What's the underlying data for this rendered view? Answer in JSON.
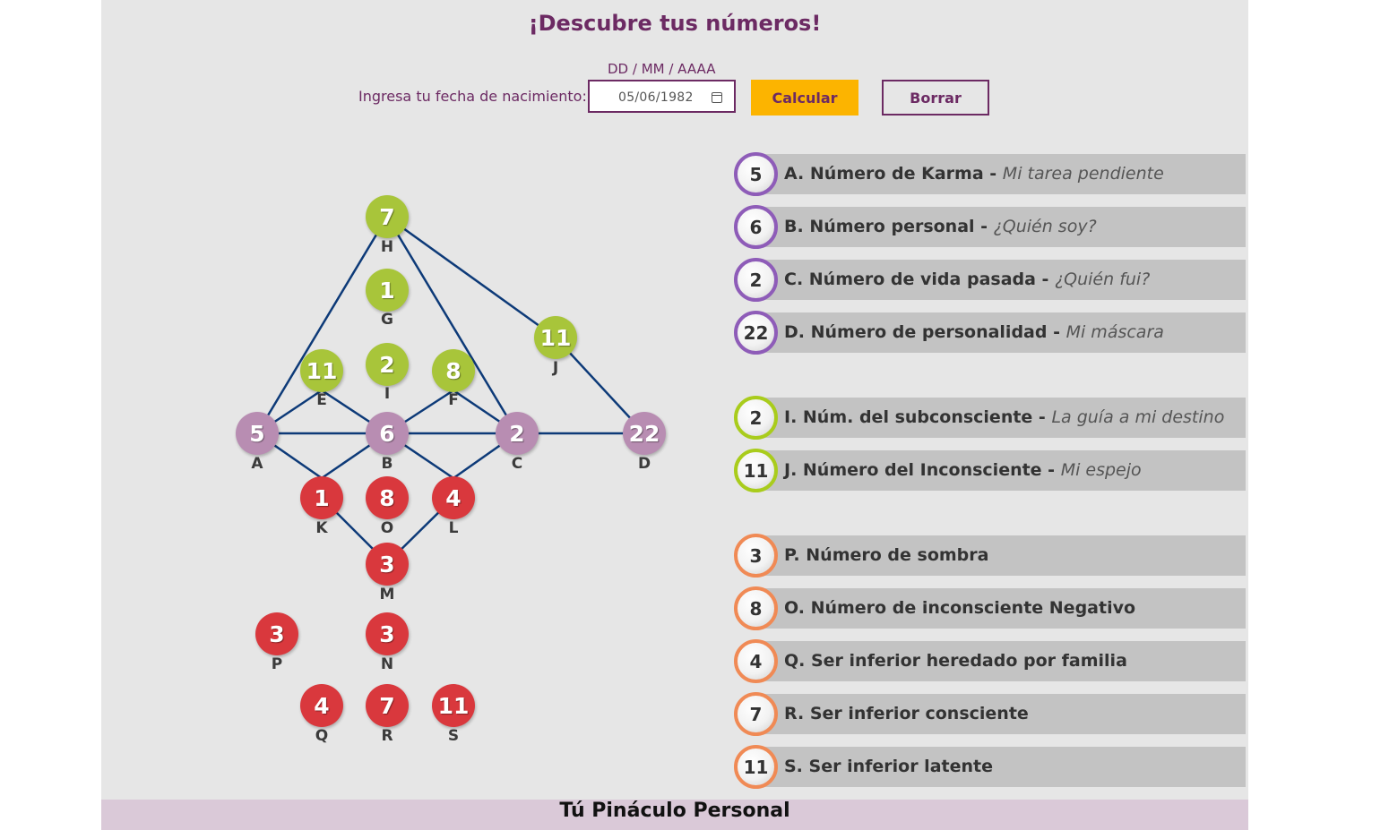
{
  "title": "¡Descubre tus números!",
  "form": {
    "format_hint": "DD / MM / AAAA",
    "label": "Ingresa tu fecha de nacimiento:",
    "date_value": "05/06/1982",
    "calc_button": "Calcular",
    "clear_button": "Borrar"
  },
  "diagram": {
    "nodes": {
      "H": {
        "value": "7",
        "label": "H"
      },
      "G": {
        "value": "1",
        "label": "G"
      },
      "I": {
        "value": "2",
        "label": "I"
      },
      "E": {
        "value": "11",
        "label": "E"
      },
      "F": {
        "value": "8",
        "label": "F"
      },
      "J": {
        "value": "11",
        "label": "J"
      },
      "A": {
        "value": "5",
        "label": "A"
      },
      "B": {
        "value": "6",
        "label": "B"
      },
      "C": {
        "value": "2",
        "label": "C"
      },
      "D": {
        "value": "22",
        "label": "D"
      },
      "K": {
        "value": "1",
        "label": "K"
      },
      "O": {
        "value": "8",
        "label": "O"
      },
      "L": {
        "value": "4",
        "label": "L"
      },
      "M": {
        "value": "3",
        "label": "M"
      },
      "P": {
        "value": "3",
        "label": "P"
      },
      "N": {
        "value": "3",
        "label": "N"
      },
      "Q": {
        "value": "4",
        "label": "Q"
      },
      "R": {
        "value": "7",
        "label": "R"
      },
      "S": {
        "value": "11",
        "label": "S"
      }
    }
  },
  "results": [
    {
      "value": "5",
      "title": "A. Número de Karma - ",
      "subtitle": "Mi tarea pendiente"
    },
    {
      "value": "6",
      "title": "B. Número personal - ",
      "subtitle": "¿Quién soy?"
    },
    {
      "value": "2",
      "title": "C. Número de vida pasada - ",
      "subtitle": "¿Quién fui?"
    },
    {
      "value": "22",
      "title": "D. Número de personalidad - ",
      "subtitle": "Mi máscara"
    },
    {
      "value": "2",
      "title": "I. Núm. del subconsciente - ",
      "subtitle": "La guía a mi destino"
    },
    {
      "value": "11",
      "title": "J. Número del Inconsciente - ",
      "subtitle": "Mi espejo"
    },
    {
      "value": "3",
      "title": "P. Número de sombra",
      "subtitle": ""
    },
    {
      "value": "8",
      "title": "O. Número de inconsciente Negativo",
      "subtitle": ""
    },
    {
      "value": "4",
      "title": "Q. Ser inferior heredado por familia",
      "subtitle": ""
    },
    {
      "value": "7",
      "title": "R. Ser inferior consciente",
      "subtitle": ""
    },
    {
      "value": "11",
      "title": "S. Ser inferior latente",
      "subtitle": ""
    }
  ],
  "colors": {
    "accent": "#6c2a63",
    "calc_button": "#fcb400",
    "green_node": "#a8c53a",
    "purple_node": "#b88db2",
    "red_node": "#d9383d",
    "line": "#0d3a78"
  },
  "footer": "Tú Pináculo Personal"
}
